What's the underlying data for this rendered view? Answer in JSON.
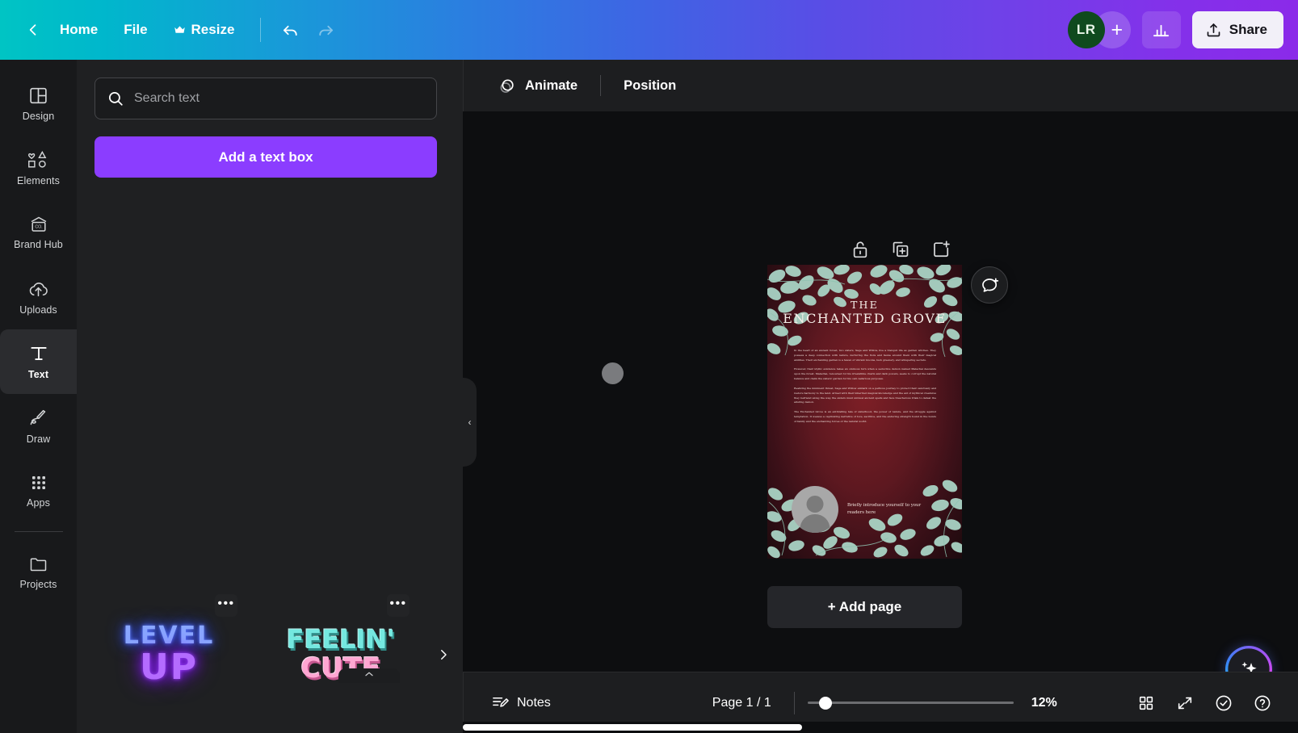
{
  "topbar": {
    "back_label": "back-arrow",
    "home_label": "Home",
    "file_label": "File",
    "resize_label": "Resize",
    "resize_crown": "crown-icon",
    "undo_label": "undo",
    "redo_label": "redo",
    "avatar_initials": "LR",
    "add_collaborator_label": "+",
    "stats_label": "stats",
    "share_label": "Share",
    "gradient_start": "#00c4c4",
    "gradient_end": "#8b2ae9"
  },
  "rail": {
    "items": [
      {
        "label": "Design",
        "icon": "design-icon",
        "active": false
      },
      {
        "label": "Elements",
        "icon": "elements-icon",
        "active": false
      },
      {
        "label": "Brand Hub",
        "icon": "brand-hub-icon",
        "active": false
      },
      {
        "label": "Uploads",
        "icon": "uploads-icon",
        "active": false
      },
      {
        "label": "Text",
        "icon": "text-icon",
        "active": true
      },
      {
        "label": "Draw",
        "icon": "draw-icon",
        "active": false
      },
      {
        "label": "Apps",
        "icon": "apps-icon",
        "active": false
      },
      {
        "label": "Projects",
        "icon": "projects-icon",
        "active": false
      }
    ]
  },
  "panel": {
    "search_placeholder": "Search text",
    "search_value": "",
    "add_text_box_label": "Add a text box",
    "card_menu_label": "•••",
    "styles": [
      {
        "line1": "LEVEL",
        "line2": "UP",
        "style": "neon"
      },
      {
        "line1": "FEELIN'",
        "line2": "CUTE",
        "style": "bubble"
      }
    ],
    "next_label": "next"
  },
  "canvas_toolbar": {
    "animate_label": "Animate",
    "position_label": "Position"
  },
  "canvas": {
    "page_tools": [
      "lock-icon",
      "duplicate-page-icon",
      "add-page-icon"
    ],
    "comment_label": "add-comment",
    "add_page_label": "+ Add page",
    "collapse_label": "‹",
    "ai_label": "magic-studio"
  },
  "poster": {
    "title_line1": "THE",
    "title_line2": "ENCHANTED GROVE",
    "paragraphs": [
      "In the heart of an ancient forest, two sisters, Sage and Willow, live a tranquil life as garden witches. They possess a deep connection with nature, nurturing the flora and fauna around them with their magical abilities. Their enchanting garden is a haven of vibrant blooms, lush greenery, and whispering secrets.",
      "However, their idyllic existence takes an ominous turn when a seductive demon named Malachai descends upon the forest. Malachai, renowned for his irresistible charm and dark powers, seeks to corrupt the natural balance and claim the sisters' garden for his own nefarious purposes.",
      "Realizing the imminent threat, Sage and Willow embark on a perilous journey to protect their sanctuary and restore harmony to the land. Armed with their inherited magical knowledge and the aid of mythical creatures they befriend along the way, the sisters must unravel ancient spells and face treacherous trials to defeat the alluring demon.",
      "The Enchanted Grove is an enthralling tale of sisterhood, the power of nature, and the struggle against temptation. It weaves a captivating narrative of love, sacrifice, and the enduring strength found in the bonds of family and the enchanting forces of the natural world."
    ],
    "profile_text": "Briefly introduce yourself to your readers here",
    "bg_color": "#5d1820",
    "leaf_color": "#a7d0c2"
  },
  "bottombar": {
    "notes_label": "Notes",
    "page_label": "Page 1 / 1",
    "zoom_level": "12%",
    "grid_label": "grid-view",
    "fullscreen_label": "fullscreen",
    "check_label": "check-circle",
    "help_label": "help"
  }
}
